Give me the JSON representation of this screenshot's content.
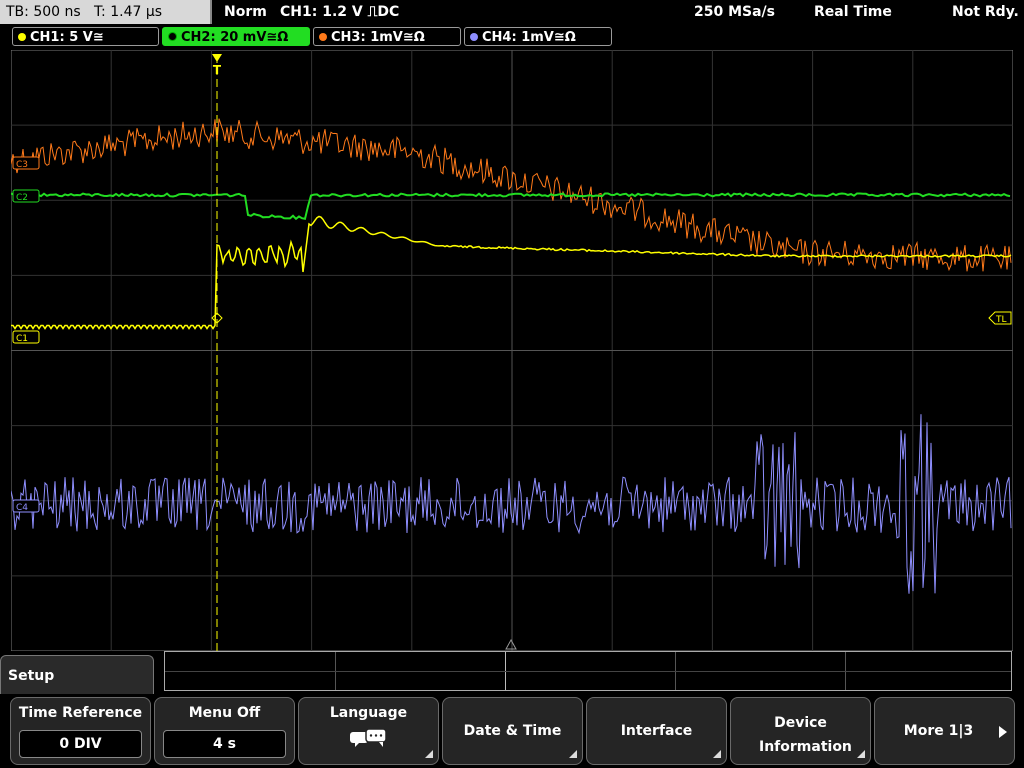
{
  "status": {
    "timebase": "TB: 500 ns",
    "trigger_time": "T: 1.47 µs",
    "mode": "Norm",
    "trigger": "CH1: 1.2 V ⎍DC",
    "sample_rate": "250 MSa/s",
    "acquisition": "Real Time",
    "state": "Not Rdy."
  },
  "channels": [
    {
      "label": "CH1: 5 V≅",
      "color": "#ffff00"
    },
    {
      "label": "CH2: 20 mV≅Ω",
      "color": "#00ff00"
    },
    {
      "label": "CH3: 1mV≅Ω",
      "color": "#ff7a1a"
    },
    {
      "label": "CH4: 1mV≅Ω",
      "color": "#8f8fff"
    }
  ],
  "markers": {
    "ch1": "C1",
    "ch2": "C2",
    "ch3": "C3",
    "ch4": "C4",
    "trigger_level": "TL",
    "trigger_pos": "T"
  },
  "menu": {
    "title": "Setup",
    "keys": [
      {
        "label": "Time Reference",
        "value": "0 DIV"
      },
      {
        "label": "Menu Off",
        "value": "4 s"
      },
      {
        "label": "Language",
        "icon": "speech-bubbles-icon"
      },
      {
        "label": "Date & Time"
      },
      {
        "label": "Interface"
      },
      {
        "label": "Device Information"
      },
      {
        "label": "More 1|3"
      }
    ]
  }
}
